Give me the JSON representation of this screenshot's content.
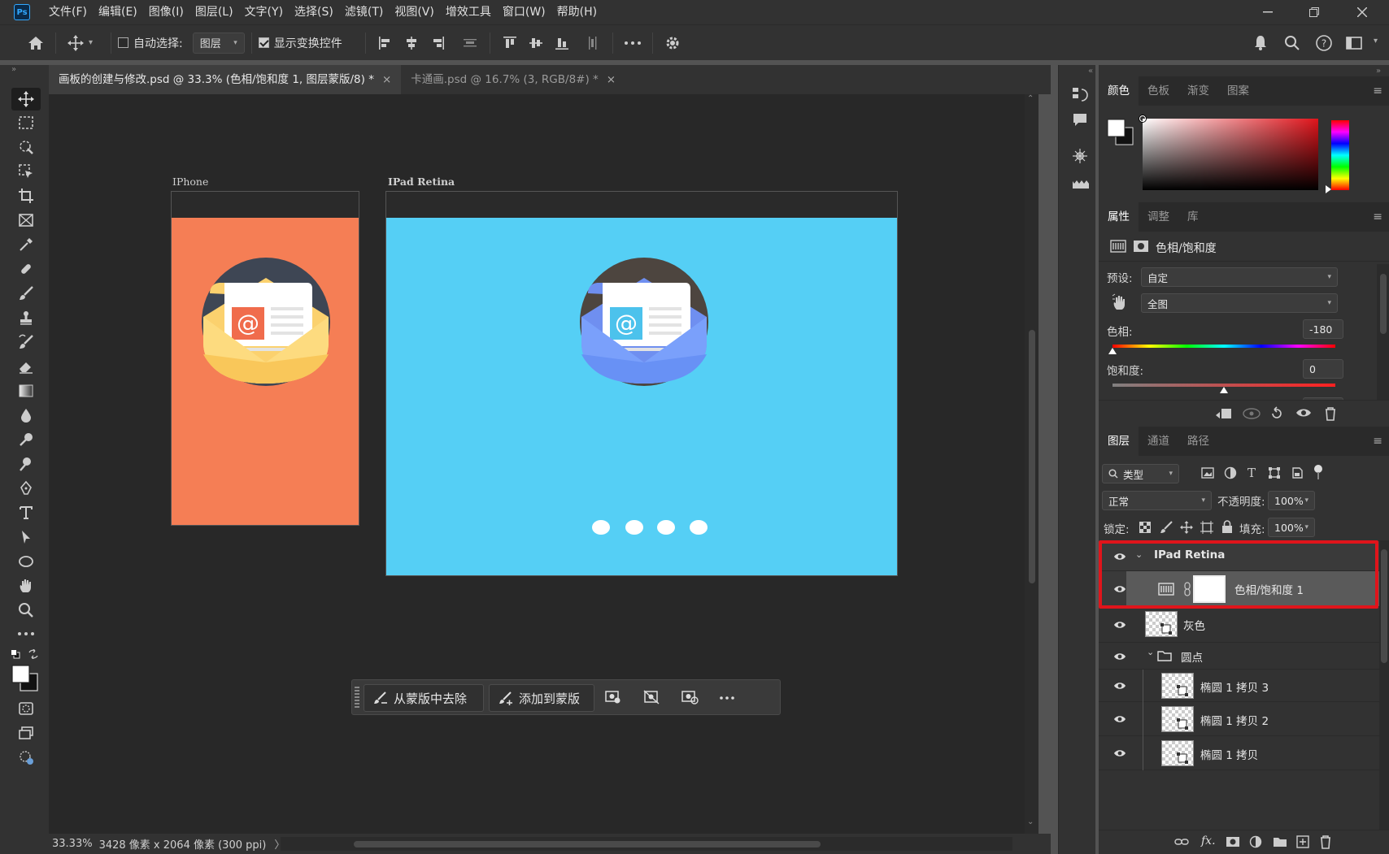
{
  "app": {
    "logo": "Ps"
  },
  "menu": [
    "文件(F)",
    "编辑(E)",
    "图像(I)",
    "图层(L)",
    "文字(Y)",
    "选择(S)",
    "滤镜(T)",
    "视图(V)",
    "增效工具",
    "窗口(W)",
    "帮助(H)"
  ],
  "options": {
    "auto_select_label": "自动选择:",
    "auto_select_target": "图层",
    "show_transform_label": "显示变换控件"
  },
  "tabs": [
    {
      "label": "画板的创建与修改.psd @ 33.3% (色相/饱和度 1, 图层蒙版/8) *",
      "close": "×"
    },
    {
      "label": "卡通画.psd @ 16.7% (3, RGB/8#) *",
      "close": "×"
    }
  ],
  "canvas": {
    "artboard1_label": "IPhone",
    "artboard2_label": "IPad Retina"
  },
  "floatbar": {
    "remove_label": "从蒙版中去除",
    "add_label": "添加到蒙版"
  },
  "status": {
    "zoom": "33.33%",
    "doc_info": "3428 像素 x 2064 像素 (300 ppi)",
    "arrow": "〉"
  },
  "color_panel": {
    "tabs": [
      "颜色",
      "色板",
      "渐变",
      "图案"
    ]
  },
  "properties": {
    "tabs": [
      "属性",
      "调整",
      "库"
    ],
    "title": "色相/饱和度",
    "preset_label": "预设:",
    "preset_value": "自定",
    "range_value": "全图",
    "hue_label": "色相:",
    "hue_value": "-180",
    "hue_fraction": 0,
    "sat_label": "饱和度:",
    "sat_value": "0",
    "sat_fraction": 0.5
  },
  "layers_panel": {
    "tabs": [
      "图层",
      "通道",
      "路径"
    ],
    "filter_label": "类型",
    "blend_mode": "正常",
    "opacity_label": "不透明度:",
    "opacity_value": "100%",
    "lock_label": "锁定:",
    "fill_label": "填充:",
    "fill_value": "100%",
    "layers": [
      {
        "name": "IPad Retina"
      },
      {
        "name": "色相/饱和度 1"
      },
      {
        "name": "灰色"
      },
      {
        "name": "圆点"
      },
      {
        "name": "椭圆 1 拷贝 3"
      },
      {
        "name": "椭圆 1 拷贝 2"
      },
      {
        "name": "椭圆 1 拷贝"
      }
    ],
    "footer_fx": "fx."
  },
  "colors": {
    "iphone_bg": "#f57e55",
    "ipad_bg": "#55cff5",
    "highlight": "#e0141b"
  }
}
